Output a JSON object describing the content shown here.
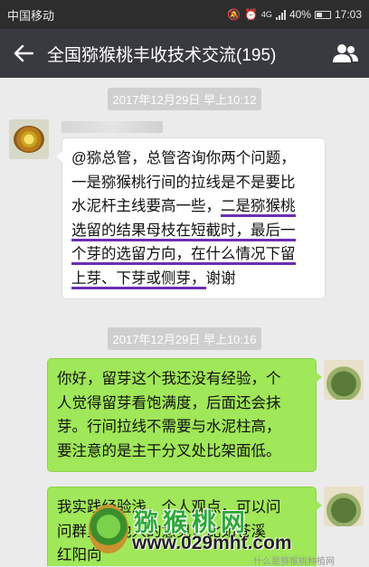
{
  "status_bar": {
    "carrier": "中国移动",
    "network": "4G",
    "battery": "40%",
    "time": "17:03"
  },
  "header": {
    "title": "全国猕猴桃丰收技术交流(195)"
  },
  "messages": [
    {
      "timestamp": "2017年12月29日 早上10:12",
      "side": "left",
      "avatar": "kiwi-avatar",
      "lines": [
        [
          {
            "t": "@猕总管，总管咨询你两个问题，"
          }
        ],
        [
          {
            "t": "一是猕猴桃行间的拉线是不是要比"
          }
        ],
        [
          {
            "t": "水泥杆主线要高一些，"
          },
          {
            "t": "二是猕猴桃",
            "u": true
          }
        ],
        [
          {
            "t": "选留的结果母枝在短截时，最后一",
            "u": true
          }
        ],
        [
          {
            "t": "个芽的选留方向，在什么情况下留",
            "u": true
          }
        ],
        [
          {
            "t": "上芽、下芽或侧芽，",
            "u": true
          },
          {
            "t": "谢谢"
          }
        ]
      ]
    },
    {
      "timestamp": "2017年12月29日 早上10:16",
      "side": "right",
      "avatar": "cake-avatar",
      "lines": [
        [
          {
            "t": "你好，留芽这个我还没有经验，个"
          }
        ],
        [
          {
            "t": "人觉得留芽看饱满度，后面还会抹"
          }
        ],
        [
          {
            "t": "芽。行间拉线不需要与水泥柱高，"
          }
        ],
        [
          {
            "t": "要注意的是主干分叉处比架面低。"
          }
        ]
      ]
    },
    {
      "side": "right",
      "avatar": "cake-avatar",
      "lines": [
        [
          {
            "t": "我实践经验浅，个人观点，可以问"
          }
        ],
        [
          {
            "t": "问群里其他人的意见，比如苍溪"
          }
        ],
        [
          {
            "t": "红阳向"
          }
        ]
      ]
    }
  ],
  "watermark": {
    "brand": "猕猴桃网",
    "url": "www.029mht.com",
    "corner": "什么是猕猴桃种植网"
  }
}
